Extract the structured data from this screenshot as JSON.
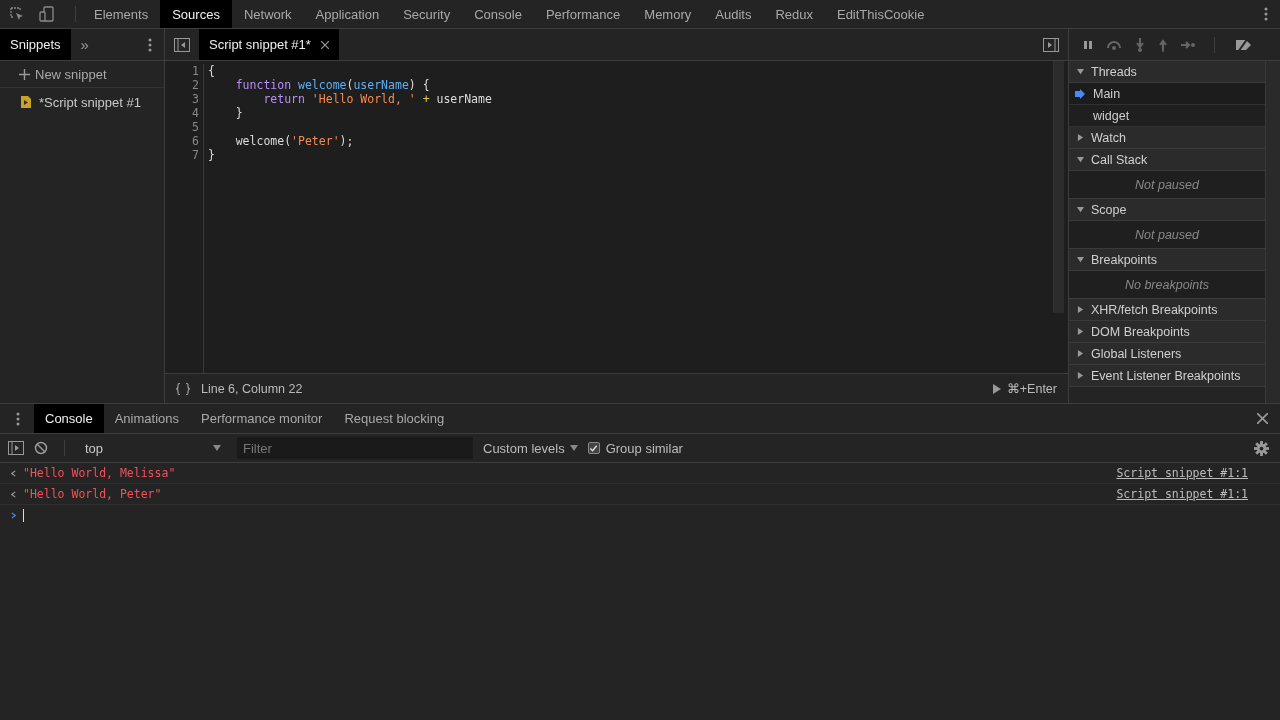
{
  "main_tabs": [
    {
      "label": "Elements",
      "selected": false
    },
    {
      "label": "Sources",
      "selected": true
    },
    {
      "label": "Network",
      "selected": false
    },
    {
      "label": "Application",
      "selected": false
    },
    {
      "label": "Security",
      "selected": false
    },
    {
      "label": "Console",
      "selected": false
    },
    {
      "label": "Performance",
      "selected": false
    },
    {
      "label": "Memory",
      "selected": false
    },
    {
      "label": "Audits",
      "selected": false
    },
    {
      "label": "Redux",
      "selected": false
    },
    {
      "label": "EditThisCookie",
      "selected": false
    }
  ],
  "navigator": {
    "tabs": [
      {
        "label": "Snippets",
        "selected": true
      }
    ],
    "more": "»",
    "new_item": "New snippet",
    "files": [
      {
        "label": "*Script snippet #1",
        "selected": false
      }
    ]
  },
  "editor": {
    "tabs": [
      {
        "label": "Script snippet #1*",
        "selected": true
      }
    ],
    "lines": [
      {
        "number": "1",
        "tokens": [
          {
            "kind": "plain",
            "text": "{"
          }
        ]
      },
      {
        "number": "2",
        "tokens": [
          {
            "kind": "keyword",
            "text": "    function "
          },
          {
            "kind": "def",
            "text": "welcome"
          },
          {
            "kind": "plain",
            "text": "("
          },
          {
            "kind": "def",
            "text": "userName"
          },
          {
            "kind": "plain",
            "text": ") {"
          }
        ]
      },
      {
        "number": "3",
        "tokens": [
          {
            "kind": "keyword",
            "text": "        return "
          },
          {
            "kind": "string",
            "text": "'Hello World, ' "
          },
          {
            "kind": "op",
            "text": "+"
          },
          {
            "kind": "plain",
            "text": " userName"
          }
        ]
      },
      {
        "number": "4",
        "tokens": [
          {
            "kind": "plain",
            "text": "    }"
          }
        ]
      },
      {
        "number": "5"
      },
      {
        "number": "6",
        "tokens": [
          {
            "kind": "plain",
            "text": "    welcome("
          },
          {
            "kind": "string",
            "text": "'Peter'"
          },
          {
            "kind": "plain",
            "text": ");"
          }
        ]
      },
      {
        "number": "7",
        "tokens": [
          {
            "kind": "plain",
            "text": "}"
          }
        ]
      }
    ],
    "status": "Line 6, Column 22",
    "run_hint": "⌘+Enter"
  },
  "debugger": {
    "sections": [
      {
        "title": "Threads",
        "expanded": true,
        "items": [
          {
            "label": "Main",
            "selected": true
          },
          {
            "label": "widget",
            "selected": false
          }
        ]
      },
      {
        "title": "Watch",
        "expanded": false
      },
      {
        "title": "Call Stack",
        "expanded": true,
        "placeholder": "Not paused"
      },
      {
        "title": "Scope",
        "expanded": true,
        "placeholder": "Not paused"
      },
      {
        "title": "Breakpoints",
        "expanded": true,
        "placeholder": "No breakpoints"
      },
      {
        "title": "XHR/fetch Breakpoints",
        "expanded": false
      },
      {
        "title": "DOM Breakpoints",
        "expanded": false
      },
      {
        "title": "Global Listeners",
        "expanded": false
      },
      {
        "title": "Event Listener Breakpoints",
        "expanded": false
      }
    ]
  },
  "drawer": {
    "tabs": [
      {
        "label": "Console",
        "selected": true
      },
      {
        "label": "Animations",
        "selected": false
      },
      {
        "label": "Performance monitor",
        "selected": false
      },
      {
        "label": "Request blocking",
        "selected": false
      }
    ],
    "context": "top",
    "filter": {
      "placeholder": "Filter"
    },
    "levels": "Custom levels",
    "group_similar": {
      "label": "Group similar",
      "checked": true
    },
    "messages": [
      {
        "text": "\"Hello World, Melissa\"",
        "source": "Script snippet #1:1"
      },
      {
        "text": "\"Hello World, Peter\"",
        "source": "Script snippet #1:1"
      }
    ]
  }
}
